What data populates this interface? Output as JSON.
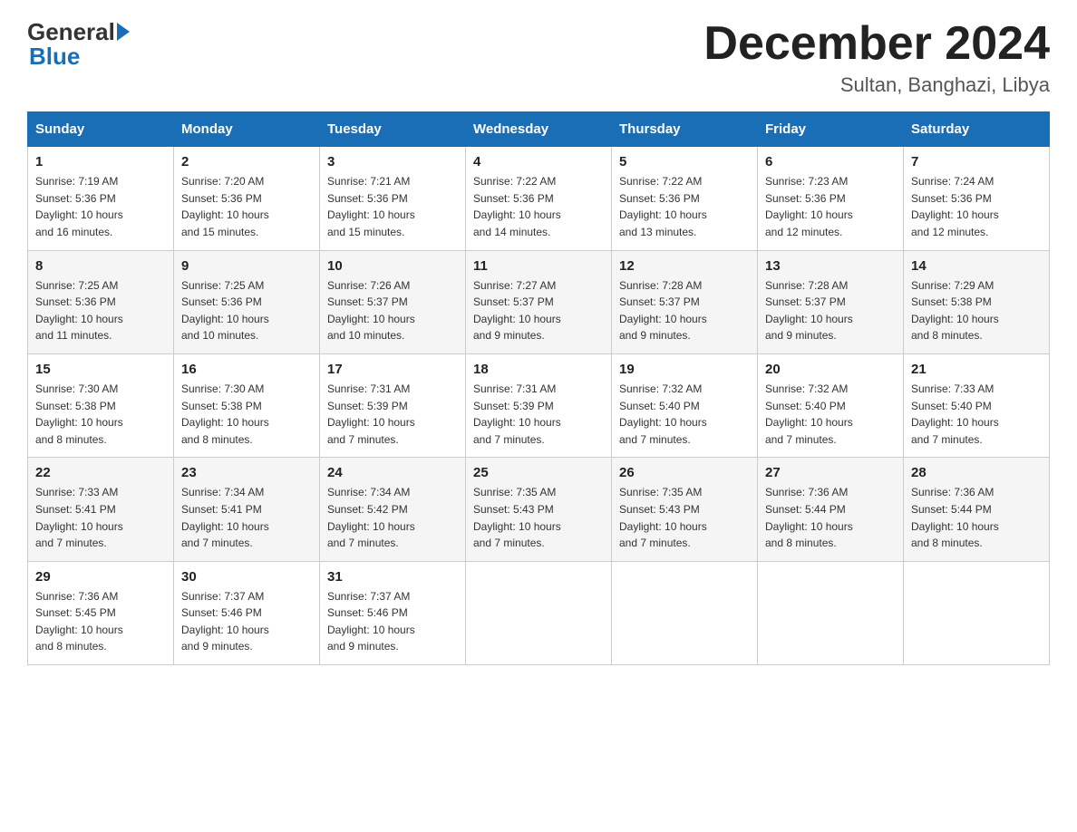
{
  "logo": {
    "general": "General",
    "blue": "Blue"
  },
  "title": "December 2024",
  "subtitle": "Sultan, Banghazi, Libya",
  "days_of_week": [
    "Sunday",
    "Monday",
    "Tuesday",
    "Wednesday",
    "Thursday",
    "Friday",
    "Saturday"
  ],
  "weeks": [
    [
      {
        "day": "1",
        "sunrise": "7:19 AM",
        "sunset": "5:36 PM",
        "daylight": "10 hours and 16 minutes."
      },
      {
        "day": "2",
        "sunrise": "7:20 AM",
        "sunset": "5:36 PM",
        "daylight": "10 hours and 15 minutes."
      },
      {
        "day": "3",
        "sunrise": "7:21 AM",
        "sunset": "5:36 PM",
        "daylight": "10 hours and 15 minutes."
      },
      {
        "day": "4",
        "sunrise": "7:22 AM",
        "sunset": "5:36 PM",
        "daylight": "10 hours and 14 minutes."
      },
      {
        "day": "5",
        "sunrise": "7:22 AM",
        "sunset": "5:36 PM",
        "daylight": "10 hours and 13 minutes."
      },
      {
        "day": "6",
        "sunrise": "7:23 AM",
        "sunset": "5:36 PM",
        "daylight": "10 hours and 12 minutes."
      },
      {
        "day": "7",
        "sunrise": "7:24 AM",
        "sunset": "5:36 PM",
        "daylight": "10 hours and 12 minutes."
      }
    ],
    [
      {
        "day": "8",
        "sunrise": "7:25 AM",
        "sunset": "5:36 PM",
        "daylight": "10 hours and 11 minutes."
      },
      {
        "day": "9",
        "sunrise": "7:25 AM",
        "sunset": "5:36 PM",
        "daylight": "10 hours and 10 minutes."
      },
      {
        "day": "10",
        "sunrise": "7:26 AM",
        "sunset": "5:37 PM",
        "daylight": "10 hours and 10 minutes."
      },
      {
        "day": "11",
        "sunrise": "7:27 AM",
        "sunset": "5:37 PM",
        "daylight": "10 hours and 9 minutes."
      },
      {
        "day": "12",
        "sunrise": "7:28 AM",
        "sunset": "5:37 PM",
        "daylight": "10 hours and 9 minutes."
      },
      {
        "day": "13",
        "sunrise": "7:28 AM",
        "sunset": "5:37 PM",
        "daylight": "10 hours and 9 minutes."
      },
      {
        "day": "14",
        "sunrise": "7:29 AM",
        "sunset": "5:38 PM",
        "daylight": "10 hours and 8 minutes."
      }
    ],
    [
      {
        "day": "15",
        "sunrise": "7:30 AM",
        "sunset": "5:38 PM",
        "daylight": "10 hours and 8 minutes."
      },
      {
        "day": "16",
        "sunrise": "7:30 AM",
        "sunset": "5:38 PM",
        "daylight": "10 hours and 8 minutes."
      },
      {
        "day": "17",
        "sunrise": "7:31 AM",
        "sunset": "5:39 PM",
        "daylight": "10 hours and 7 minutes."
      },
      {
        "day": "18",
        "sunrise": "7:31 AM",
        "sunset": "5:39 PM",
        "daylight": "10 hours and 7 minutes."
      },
      {
        "day": "19",
        "sunrise": "7:32 AM",
        "sunset": "5:40 PM",
        "daylight": "10 hours and 7 minutes."
      },
      {
        "day": "20",
        "sunrise": "7:32 AM",
        "sunset": "5:40 PM",
        "daylight": "10 hours and 7 minutes."
      },
      {
        "day": "21",
        "sunrise": "7:33 AM",
        "sunset": "5:40 PM",
        "daylight": "10 hours and 7 minutes."
      }
    ],
    [
      {
        "day": "22",
        "sunrise": "7:33 AM",
        "sunset": "5:41 PM",
        "daylight": "10 hours and 7 minutes."
      },
      {
        "day": "23",
        "sunrise": "7:34 AM",
        "sunset": "5:41 PM",
        "daylight": "10 hours and 7 minutes."
      },
      {
        "day": "24",
        "sunrise": "7:34 AM",
        "sunset": "5:42 PM",
        "daylight": "10 hours and 7 minutes."
      },
      {
        "day": "25",
        "sunrise": "7:35 AM",
        "sunset": "5:43 PM",
        "daylight": "10 hours and 7 minutes."
      },
      {
        "day": "26",
        "sunrise": "7:35 AM",
        "sunset": "5:43 PM",
        "daylight": "10 hours and 7 minutes."
      },
      {
        "day": "27",
        "sunrise": "7:36 AM",
        "sunset": "5:44 PM",
        "daylight": "10 hours and 8 minutes."
      },
      {
        "day": "28",
        "sunrise": "7:36 AM",
        "sunset": "5:44 PM",
        "daylight": "10 hours and 8 minutes."
      }
    ],
    [
      {
        "day": "29",
        "sunrise": "7:36 AM",
        "sunset": "5:45 PM",
        "daylight": "10 hours and 8 minutes."
      },
      {
        "day": "30",
        "sunrise": "7:37 AM",
        "sunset": "5:46 PM",
        "daylight": "10 hours and 9 minutes."
      },
      {
        "day": "31",
        "sunrise": "7:37 AM",
        "sunset": "5:46 PM",
        "daylight": "10 hours and 9 minutes."
      },
      null,
      null,
      null,
      null
    ]
  ],
  "labels": {
    "sunrise": "Sunrise:",
    "sunset": "Sunset:",
    "daylight": "Daylight:"
  }
}
